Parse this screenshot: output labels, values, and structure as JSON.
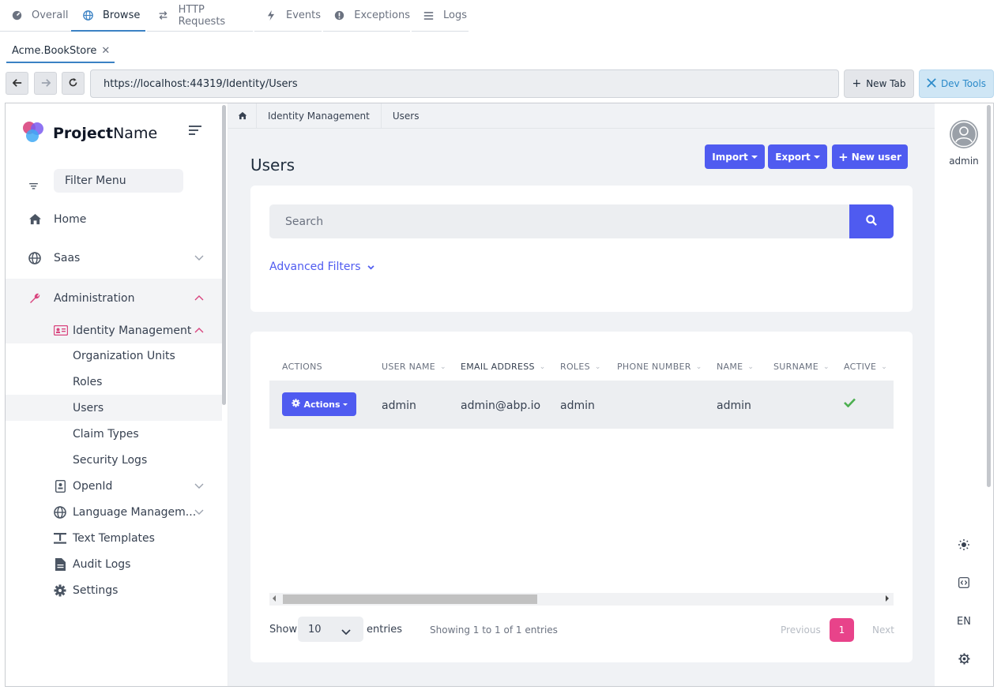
{
  "top_tabs": [
    {
      "label": "Overall",
      "icon": "dashboard-icon"
    },
    {
      "label": "Browse",
      "icon": "globe-icon"
    },
    {
      "label": "HTTP Requests",
      "icon": "arrows-icon"
    },
    {
      "label": "Events",
      "icon": "bolt-icon"
    },
    {
      "label": "Exceptions",
      "icon": "exclamation-icon"
    },
    {
      "label": "Logs",
      "icon": "list-icon"
    }
  ],
  "doc_tab": {
    "label": "Acme.BookStore"
  },
  "nav": {
    "url": "https://localhost:44319/Identity/Users",
    "new_tab": "New Tab",
    "dev_tools": "Dev Tools"
  },
  "sidebar": {
    "brand_bold": "Project",
    "brand_rest": "Name",
    "filter_placeholder": "Filter Menu",
    "items": [
      {
        "label": "Home",
        "icon": "home-icon"
      },
      {
        "label": "Saas",
        "icon": "globe-icon"
      },
      {
        "label": "Administration",
        "icon": "wrench-icon"
      },
      {
        "label": "Identity Management",
        "icon": "id-card-icon"
      },
      {
        "label": "Organization Units"
      },
      {
        "label": "Roles"
      },
      {
        "label": "Users"
      },
      {
        "label": "Claim Types"
      },
      {
        "label": "Security Logs"
      },
      {
        "label": "OpenId",
        "icon": "id-badge-icon"
      },
      {
        "label": "Language Managem...",
        "icon": "globe-icon"
      },
      {
        "label": "Text Templates",
        "icon": "text-template-icon"
      },
      {
        "label": "Audit Logs",
        "icon": "file-icon"
      },
      {
        "label": "Settings",
        "icon": "gear-icon"
      }
    ]
  },
  "breadcrumb": [
    "Identity Management",
    "Users"
  ],
  "page": {
    "title": "Users",
    "import_label": "Import",
    "export_label": "Export",
    "new_user_label": "New user"
  },
  "search": {
    "placeholder": "Search",
    "advanced_filters": "Advanced Filters"
  },
  "table": {
    "headers": [
      "ACTIONS",
      "USER NAME",
      "EMAIL ADDRESS",
      "ROLES",
      "PHONE NUMBER",
      "NAME",
      "SURNAME",
      "ACTIVE"
    ],
    "rows": [
      {
        "actions_label": "Actions",
        "user_name": "admin",
        "email": "admin@abp.io",
        "roles": "admin",
        "phone": "",
        "name": "admin",
        "surname": "",
        "active": true
      }
    ]
  },
  "footer": {
    "show_label": "Show",
    "entries_value": "10",
    "entries_label": "entries",
    "showing_text": "Showing 1 to 1 of 1 entries",
    "previous": "Previous",
    "page": "1",
    "next": "Next"
  },
  "rail": {
    "user": "admin",
    "language": "EN"
  },
  "colors": {
    "primary": "#4f5bf0",
    "accent_pink": "#e8438a",
    "active_tab": "#3b82c4",
    "success": "#4caf50"
  }
}
